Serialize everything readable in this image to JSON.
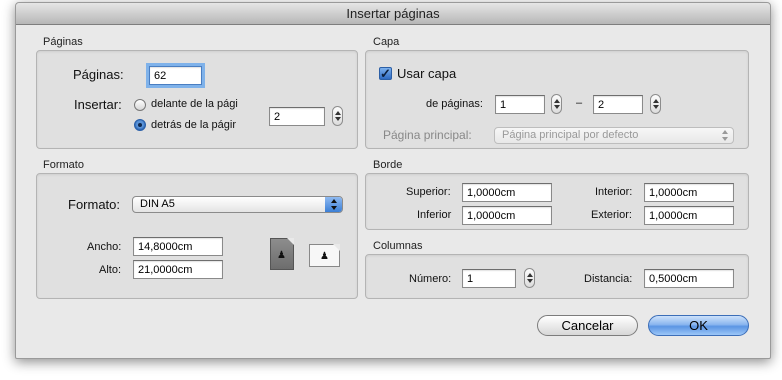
{
  "window": {
    "title": "Insertar páginas"
  },
  "paginas": {
    "section": "Páginas",
    "paginas_label": "Páginas:",
    "paginas_value": "62",
    "insertar_label": "Insertar:",
    "option_before": "delante de la pági",
    "option_after": "detrás de la págir",
    "selected": "after",
    "page_value": "2"
  },
  "capa": {
    "section": "Capa",
    "usar_capa": "Usar capa",
    "usar_capa_checked": true,
    "de_paginas_label": "de páginas:",
    "from_value": "1",
    "dash": "–",
    "to_value": "2",
    "pagina_principal_label": "Página principal:",
    "pagina_principal_value": "Página principal por defecto"
  },
  "formato": {
    "section": "Formato",
    "formato_label": "Formato:",
    "formato_value": "DIN A5",
    "ancho_label": "Ancho:",
    "ancho_value": "14,8000cm",
    "alto_label": "Alto:",
    "alto_value": "21,0000cm",
    "orientation_glyph": "♟",
    "orientation_selected": "portrait"
  },
  "borde": {
    "section": "Borde",
    "superior_label": "Superior:",
    "superior_value": "1,0000cm",
    "inferior_label": "Inferior",
    "inferior_value": "1,0000cm",
    "interior_label": "Interior:",
    "interior_value": "1,0000cm",
    "exterior_label": "Exterior:",
    "exterior_value": "1,0000cm"
  },
  "columnas": {
    "section": "Columnas",
    "numero_label": "Número:",
    "numero_value": "1",
    "distancia_label": "Distancia:",
    "distancia_value": "0,5000cm"
  },
  "buttons": {
    "cancel": "Cancelar",
    "ok": "OK"
  },
  "colors": {
    "accent": "#5b95e4",
    "focus_ring": "#7fb2ea",
    "window_bg": "#e9e9e9"
  }
}
